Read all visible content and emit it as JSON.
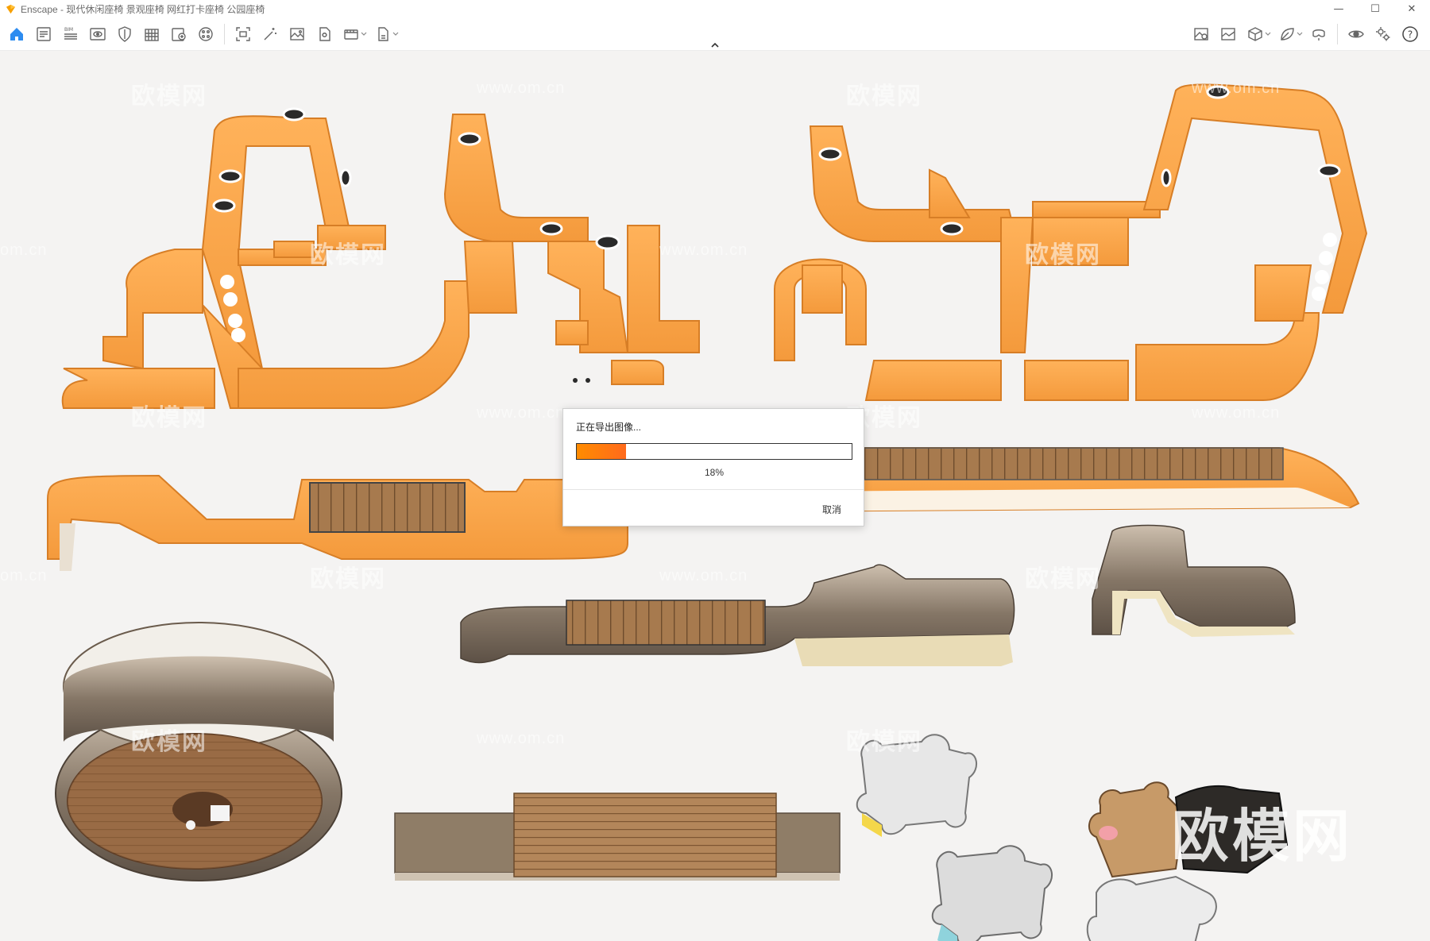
{
  "window": {
    "title": "Enscape - 现代休闲座椅 景观座椅 网红打卡座椅 公园座椅",
    "minimize_glyph": "—",
    "maximize_glyph": "☐",
    "close_glyph": "✕"
  },
  "toolbar": {
    "left_icons": [
      "home-icon",
      "document-icon",
      "bim-icon",
      "eye-view-icon",
      "shield-icon",
      "building-icon",
      "asset-icon",
      "palette-icon",
      "screenshot-icon",
      "magic-wand-icon",
      "image-icon",
      "panorama-icon",
      "video-icon",
      "export-icon"
    ],
    "bim_label": "BIM",
    "right_icons": [
      "settings-image-icon",
      "gallery-icon",
      "cube-icon",
      "leaf-icon",
      "vr-headset-icon",
      "visibility-icon",
      "gear-icon",
      "help-icon"
    ],
    "help_glyph": "?"
  },
  "dialog": {
    "title": "正在导出图像...",
    "progress_percent": 18,
    "progress_label": "18%",
    "cancel_label": "取消"
  },
  "watermarks": {
    "logo_text": "欧模网",
    "url_text": "www.om.cn",
    "short_url": "om.cn",
    "big_logo": "欧模网"
  },
  "colors": {
    "accent_orange": "#f49a3c",
    "progress_orange": "#ff7a10",
    "wood": "#a77a4e",
    "bronze": "#7d7266",
    "viewport_bg": "#f4f3f2",
    "home_blue": "#2d8cf0"
  }
}
